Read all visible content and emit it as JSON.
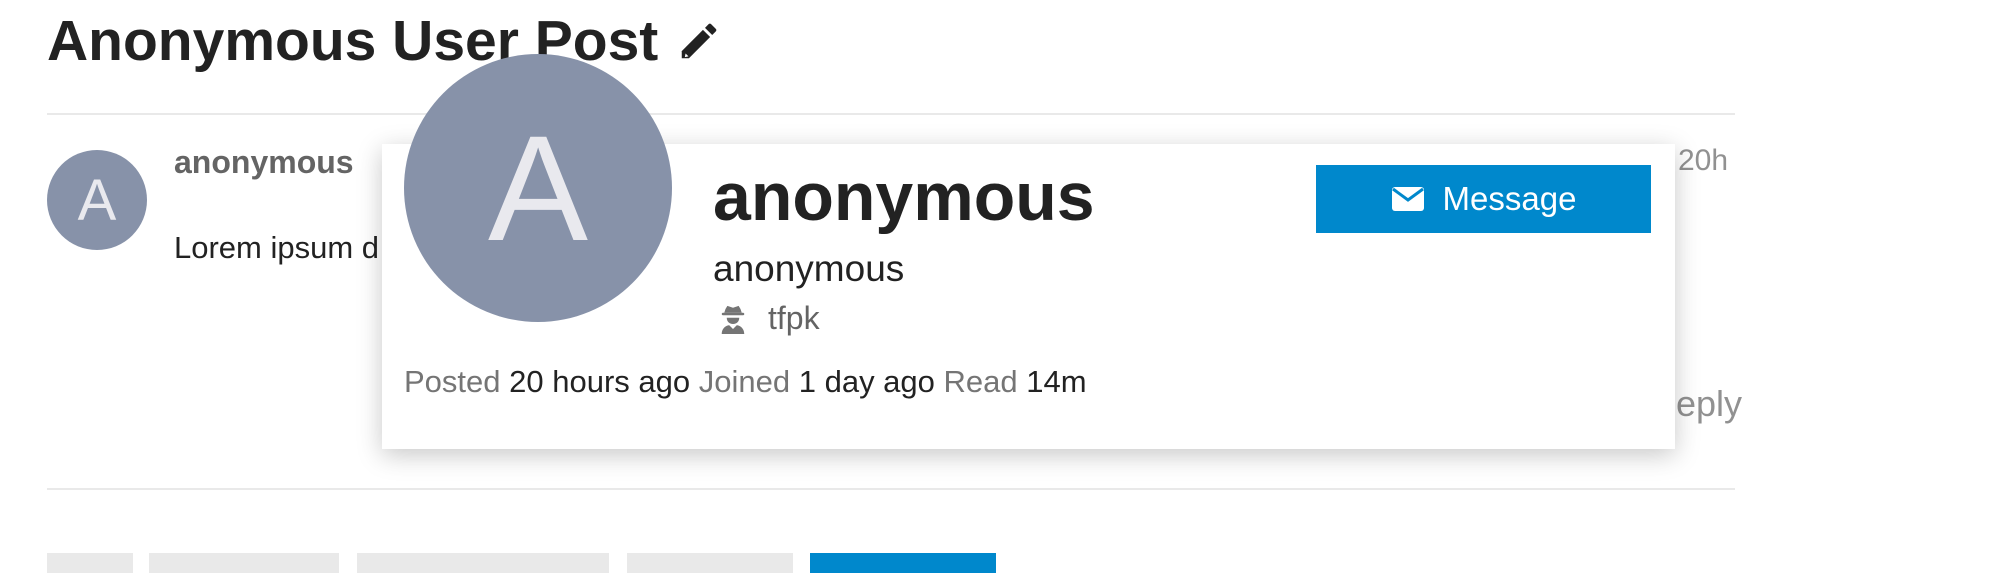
{
  "topic": {
    "title": "Anonymous User Post",
    "edit_icon": "pencil-icon"
  },
  "post": {
    "avatar_letter": "A",
    "username": "anonymous",
    "date": "20h",
    "body": "Lorem ipsum d",
    "reply_label": "Reply"
  },
  "user_card": {
    "avatar_letter": "A",
    "name": "anonymous",
    "username": "anonymous",
    "group_icon": "user-secret-icon",
    "group": "tfpk",
    "message_icon": "envelope-icon",
    "message_label": "Message",
    "meta": {
      "posted_label": "Posted",
      "posted_value": "20 hours ago",
      "joined_label": "Joined",
      "joined_value": "1 day ago",
      "read_label": "Read",
      "read_value": "14m"
    }
  },
  "colors": {
    "accent": "#0088cc",
    "avatar_bg": "#8792a9",
    "muted_text": "#919191",
    "divider": "#e9e9e9"
  }
}
